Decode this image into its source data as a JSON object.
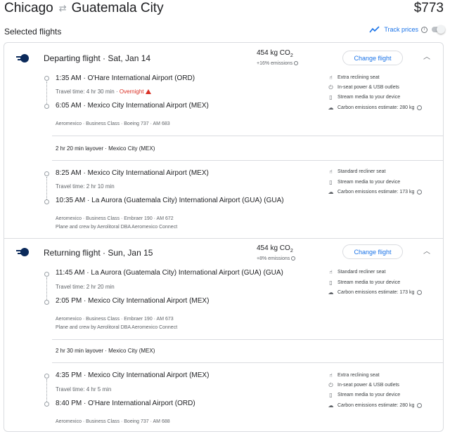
{
  "header": {
    "origin": "Chicago",
    "destination": "Guatemala City",
    "price": "$773"
  },
  "subheader": {
    "title": "Selected flights",
    "track_prices_label": "Track prices"
  },
  "departing": {
    "title": "Departing flight · Sat, Jan 14",
    "co2": "454 kg CO",
    "co2_sub": "2",
    "emissions": "+16% emissions",
    "change_label": "Change flight",
    "leg1": {
      "dep": "1:35 AM  ·  O'Hare International Airport (ORD)",
      "travel": "Travel time: 4 hr 30 min · ",
      "overnight": "Overnight",
      "arr": "6:05 AM  ·  Mexico City International Airport (MEX)",
      "meta": "Aeromexico · Business Class · Boeing 737 · AM 683",
      "amenities": [
        "Extra reclining seat",
        "In-seat power & USB outlets",
        "Stream media to your device",
        "Carbon emissions estimate: 280 kg"
      ]
    },
    "layover": "2 hr 20 min layover · Mexico City (MEX)",
    "leg2": {
      "dep": "8:25 AM  ·  Mexico City International Airport (MEX)",
      "travel": "Travel time: 2 hr 10 min",
      "arr": "10:35 AM  ·  La Aurora (Guatemala City) International Airport (GUA) (GUA)",
      "meta": "Aeromexico · Business Class · Embraer 190 · AM 672",
      "meta2": "Plane and crew by Aerolitoral DBA Aeromexico Connect",
      "amenities": [
        "Standard recliner seat",
        "Stream media to your device",
        "Carbon emissions estimate: 173 kg"
      ]
    }
  },
  "returning": {
    "title": "Returning flight · Sun, Jan 15",
    "co2": "454 kg CO",
    "co2_sub": "2",
    "emissions": "+8% emissions",
    "change_label": "Change flight",
    "leg1": {
      "dep": "11:45 AM  ·  La Aurora (Guatemala City) International Airport (GUA) (GUA)",
      "travel": "Travel time: 2 hr 20 min",
      "arr": "2:05 PM  ·  Mexico City International Airport (MEX)",
      "meta": "Aeromexico · Business Class · Embraer 190 · AM 673",
      "meta2": "Plane and crew by Aerolitoral DBA Aeromexico Connect",
      "amenities": [
        "Standard recliner seat",
        "Stream media to your device",
        "Carbon emissions estimate: 173 kg"
      ]
    },
    "layover": "2 hr 30 min layover · Mexico City (MEX)",
    "leg2": {
      "dep": "4:35 PM  ·  Mexico City International Airport (MEX)",
      "travel": "Travel time: 4 hr 5 min",
      "arr": "8:40 PM  ·  O'Hare International Airport (ORD)",
      "meta": "Aeromexico · Business Class · Boeing 737 · AM 688",
      "amenities": [
        "Extra reclining seat",
        "In-seat power & USB outlets",
        "Stream media to your device",
        "Carbon emissions estimate: 280 kg"
      ]
    }
  },
  "colors": {
    "accent": "#1a73e8",
    "warning": "#d93025",
    "muted": "#5f6368"
  },
  "icons": [
    "swap-arrows-icon",
    "trend-line-icon",
    "info-icon",
    "aeromexico-logo",
    "chevron-up-icon",
    "warning-triangle-icon",
    "seat-icon",
    "power-icon",
    "phone-icon",
    "co2-icon"
  ]
}
